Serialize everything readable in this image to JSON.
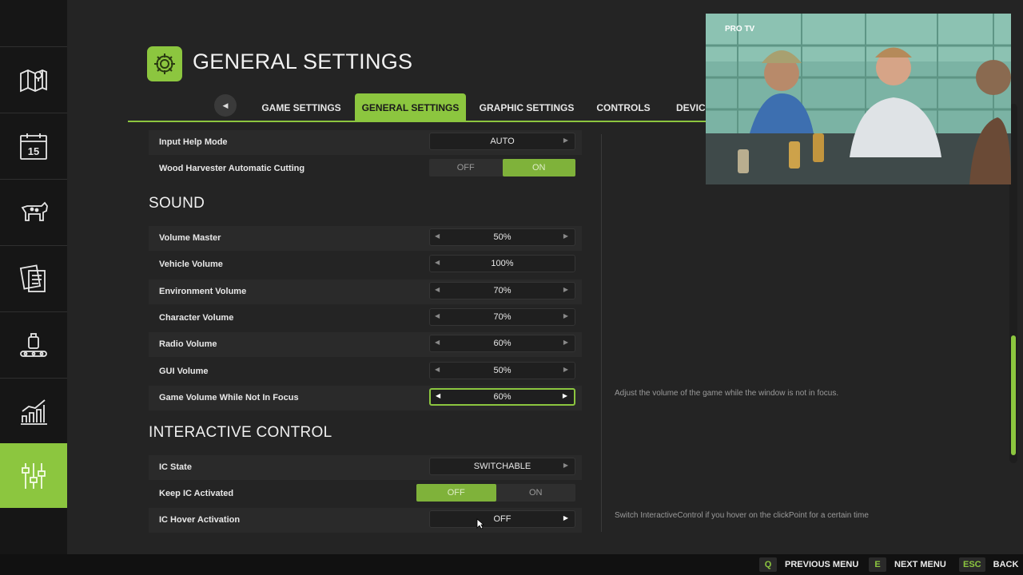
{
  "page": {
    "title": "GENERAL SETTINGS",
    "title_icon": "gear-icon"
  },
  "sidebar": {
    "items": [
      {
        "icon": "map-icon"
      },
      {
        "icon": "calendar-icon",
        "text": "15"
      },
      {
        "icon": "animals-icon"
      },
      {
        "icon": "contracts-icon"
      },
      {
        "icon": "production-icon"
      },
      {
        "icon": "statistics-icon"
      },
      {
        "icon": "settings-sliders-icon",
        "active": true
      }
    ]
  },
  "tabs": [
    {
      "label": "GAME SETTINGS"
    },
    {
      "label": "GENERAL SETTINGS",
      "active": true
    },
    {
      "label": "GRAPHIC SETTINGS"
    },
    {
      "label": "CONTROLS"
    },
    {
      "label": "DEVICE"
    }
  ],
  "rows_top": [
    {
      "label": "Input Help Mode",
      "value": "AUTO"
    },
    {
      "label": "Wood Harvester Automatic Cutting",
      "off": "OFF",
      "on": "ON",
      "selected": "ON"
    }
  ],
  "sound": {
    "heading": "SOUND",
    "rows": [
      {
        "label": "Volume Master",
        "value": "50%"
      },
      {
        "label": "Vehicle Volume",
        "value": "100%"
      },
      {
        "label": "Environment Volume",
        "value": "70%"
      },
      {
        "label": "Character Volume",
        "value": "70%"
      },
      {
        "label": "Radio Volume",
        "value": "60%"
      },
      {
        "label": "GUI Volume",
        "value": "50%"
      },
      {
        "label": "Game Volume While Not In Focus",
        "value": "60%",
        "focused": true
      }
    ],
    "help": "Adjust the volume of the game while the window is not in focus."
  },
  "interactive": {
    "heading": "INTERACTIVE CONTROL",
    "rows": [
      {
        "label": "IC State",
        "value": "SWITCHABLE"
      },
      {
        "label": "Keep IC Activated",
        "off": "OFF",
        "on": "ON",
        "selected": "OFF"
      },
      {
        "label": "IC Hover Activation",
        "value": "OFF"
      }
    ],
    "help": "Switch InteractiveControl if you hover on the clickPoint for a certain time"
  },
  "video": {
    "logo": "PRO TV"
  },
  "bottom": [
    {
      "key": "Q",
      "label": "PREVIOUS MENU"
    },
    {
      "key": "E",
      "label": "NEXT MENU"
    },
    {
      "key": "ESC",
      "label": "BACK"
    }
  ],
  "colors": {
    "accent": "#8cc63f",
    "background": "#242424",
    "sidebar": "#161616"
  }
}
